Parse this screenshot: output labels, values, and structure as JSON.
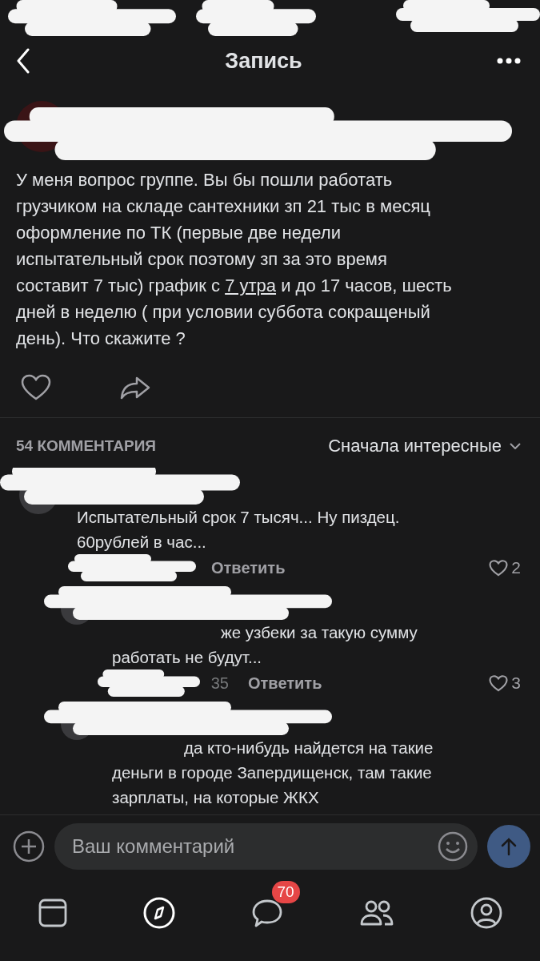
{
  "header": {
    "title": "Запись"
  },
  "post": {
    "text_before": "У меня вопрос группе. Вы бы пошли работать грузчиком на складе сантехники зп 21 тыс в месяц оформление по ТК (первые две недели испытательный срок поэтому зп за это время составит 7 тыс) график с ",
    "link": "7 утра",
    "text_after": " и до 17 часов, шесть дней в неделю ( при условии суббота сокращеный день). Что скажите ?"
  },
  "comments_header": {
    "count": "54 КОММЕНТАРИЯ",
    "sort": "Сначала интересные"
  },
  "comments": [
    {
      "text": "Испытательный срок 7 тысяч... Ну пиздец. 60рублей в час...",
      "reply": "Ответить",
      "likes": "2",
      "children": [
        {
          "text": "же узбеки за такую сумму работать не будут...",
          "time": "35",
          "reply": "Ответить",
          "likes": "3"
        },
        {
          "text": "да кто-нибудь найдется на такие деньги в городе Запердищенск, там такие зарплаты, на которые ЖКХ"
        }
      ]
    }
  ],
  "composer": {
    "placeholder": "Ваш комментарий"
  },
  "tabbar": [
    {
      "selected": false
    },
    {
      "selected": true
    },
    {
      "selected": false,
      "badge": "70"
    },
    {
      "selected": false
    },
    {
      "selected": false
    }
  ]
}
